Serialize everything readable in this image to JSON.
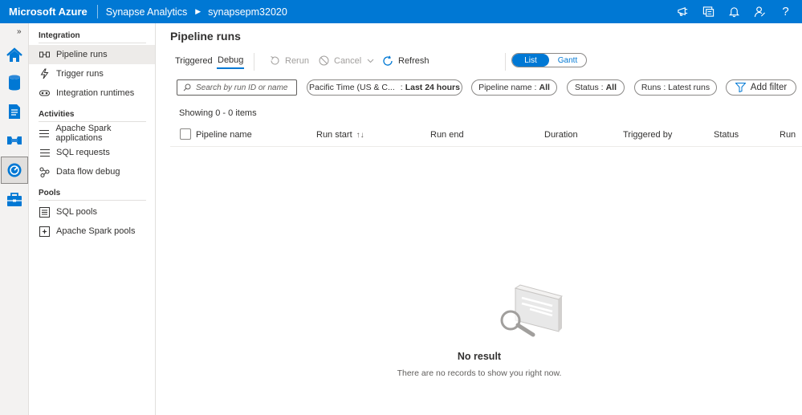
{
  "topbar": {
    "brand": "Microsoft Azure",
    "service": "Synapse Analytics",
    "workspace": "synapsepm32020",
    "icons": [
      "feedback-icon",
      "directory-icon",
      "notifications-icon",
      "settings-icon",
      "help-icon"
    ],
    "help_label": "?"
  },
  "rail": {
    "toggle": "»",
    "items": [
      "home-icon",
      "data-icon",
      "develop-icon",
      "integrate-icon",
      "monitor-icon",
      "manage-icon"
    ],
    "active": "monitor-icon"
  },
  "sidenav": {
    "sections": [
      {
        "title": "Integration",
        "items": [
          "Pipeline runs",
          "Trigger runs",
          "Integration runtimes"
        ]
      },
      {
        "title": "Activities",
        "items": [
          "Apache Spark applications",
          "SQL requests",
          "Data flow debug"
        ]
      },
      {
        "title": "Pools",
        "items": [
          "SQL pools",
          "Apache Spark pools"
        ]
      }
    ],
    "active_item": "Pipeline runs"
  },
  "main": {
    "title": "Pipeline runs",
    "tabs": [
      "Triggered",
      "Debug"
    ],
    "active_tab": "Debug",
    "commands": {
      "rerun": "Rerun",
      "cancel": "Cancel",
      "refresh": "Refresh"
    },
    "view_toggle": {
      "list": "List",
      "gantt": "Gantt",
      "selected": "List"
    }
  },
  "filters": {
    "search_placeholder": "Search by run ID or name",
    "time": {
      "zone": "Pacific Time (US & C...",
      "sep": ":",
      "value": "Last 24 hours"
    },
    "pipeline_name": {
      "label": "Pipeline name :",
      "value": "All"
    },
    "status": {
      "label": "Status :",
      "value": "All"
    },
    "runs": {
      "label": "Runs : Latest runs"
    },
    "add_filter": "Add filter"
  },
  "results": {
    "showing": "Showing 0 - 0 items",
    "columns": [
      "Pipeline name",
      "Run start",
      "Run end",
      "Duration",
      "Triggered by",
      "Status",
      "Run"
    ],
    "sort_column": "Run start",
    "sort_glyph": "↑↓"
  },
  "empty_state": {
    "title": "No result",
    "subtitle": "There are no records to show you right now."
  },
  "colors": {
    "accent": "#0078d4",
    "rail_bg": "#f3f2f1",
    "text": "#323130"
  }
}
